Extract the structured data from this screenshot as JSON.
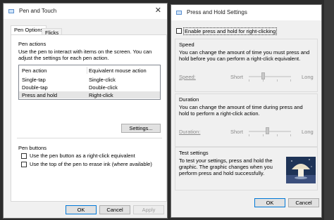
{
  "pen_touch": {
    "title": "Pen and Touch",
    "tabs": [
      "Pen Options",
      "Flicks"
    ],
    "pen_actions": {
      "title": "Pen actions",
      "description": "Use the pen to interact with items on the screen. You can adjust the settings for each pen action.",
      "col_action": "Pen action",
      "col_mouse": "Equivalent mouse action",
      "rows": [
        {
          "action": "Single-tap",
          "mouse": "Single-click"
        },
        {
          "action": "Double-tap",
          "mouse": "Double-click"
        },
        {
          "action": "Press and hold",
          "mouse": "Right-click"
        }
      ],
      "settings_button": "Settings..."
    },
    "pen_buttons": {
      "title": "Pen buttons",
      "option1": "Use the pen button as a right-click equivalent",
      "option2": "Use the top of the pen to erase ink (where available)"
    },
    "ok": "OK",
    "cancel": "Cancel",
    "apply": "Apply"
  },
  "press_hold": {
    "title": "Press and Hold Settings",
    "enable_label": "Enable press and hold for right-clicking",
    "speed": {
      "title": "Speed",
      "description": "You can change the amount of time you must press and hold before you can perform a right-click equivalent.",
      "label": "Speed:",
      "short": "Short",
      "long": "Long",
      "value": 0.5
    },
    "duration": {
      "title": "Duration",
      "description": "You can change the amount of time during press and hold to perform a right-click action.",
      "label": "Duration:",
      "short": "Short",
      "long": "Long",
      "value": 0.5
    },
    "test": {
      "title": "Test settings",
      "description": "To test your settings, press and hold the graphic. The graphic changes when you perform press and hold successfully."
    },
    "ok": "OK",
    "cancel": "Cancel"
  },
  "colors": {
    "desktop": "#2b2b2b",
    "dialog_bg": "#f0f0f0",
    "selected_row": "#e5e5e5",
    "accent": "#0078d7"
  }
}
